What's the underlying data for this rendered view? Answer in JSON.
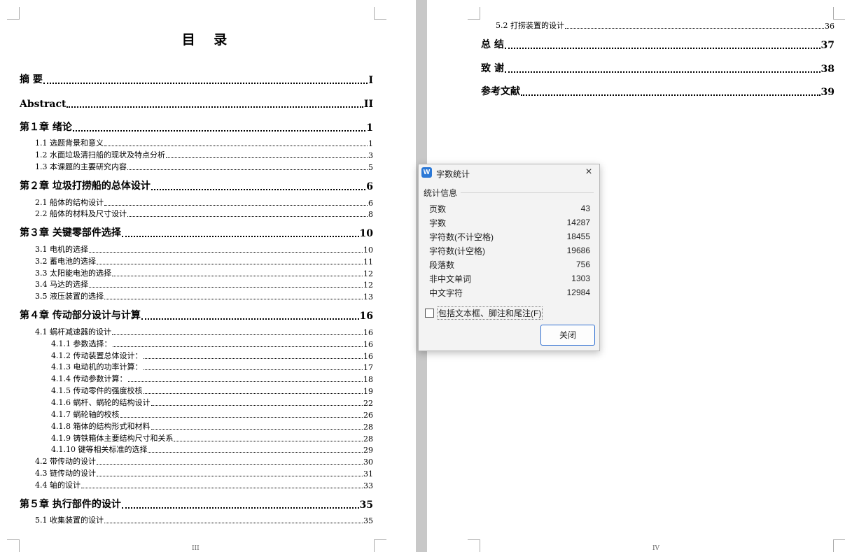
{
  "left_page": {
    "title": "目 录",
    "entries": [
      {
        "text": "摘  要",
        "page": "I"
      },
      {
        "text": "Abstract",
        "page": "II"
      },
      {
        "text": "第１章  绪论",
        "page": "1"
      },
      {
        "text": "1.1 选题背景和意义",
        "page": "1"
      },
      {
        "text": "1.2 水面垃圾清扫船的现状及特点分析",
        "page": "3"
      },
      {
        "text": "1.3 本课题的主要研究内容",
        "page": "5"
      },
      {
        "text": "第２章  垃圾打捞船的总体设计",
        "page": "6"
      },
      {
        "text": "2.1 船体的结构设计",
        "page": "6"
      },
      {
        "text": "2.2 船体的材料及尺寸设计",
        "page": "8"
      },
      {
        "text": "第３章 关键零部件选择",
        "page": "10"
      },
      {
        "text": "3.1 电机的选择",
        "page": "10"
      },
      {
        "text": "3.2 蓄电池的选择",
        "page": "11"
      },
      {
        "text": "3.3 太阳能电池的选择",
        "page": "12"
      },
      {
        "text": "3.4 马达的选择",
        "page": "12"
      },
      {
        "text": "3.5 液压装置的选择",
        "page": "13"
      },
      {
        "text": "第４章  传动部分设计与计算",
        "page": "16"
      },
      {
        "text": "4.1 蜗杆减速器的设计",
        "page": "16"
      },
      {
        "text": "4.1.1 参数选择：",
        "page": "16"
      },
      {
        "text": "4.1.2 传动装置总体设计：",
        "page": "16"
      },
      {
        "text": "4.1.3  电动机的功率计算：",
        "page": "17"
      },
      {
        "text": "4.1.4 传动参数计算：",
        "page": "18"
      },
      {
        "text": "4.1.5 传动零件的强度校核",
        "page": "19"
      },
      {
        "text": "4.1.6 蜗杆、蜗轮的结构设计",
        "page": "22"
      },
      {
        "text": "4.1.7 蜗轮轴的校核",
        "page": "26"
      },
      {
        "text": "4.1.8 箱体的结构形式和材料",
        "page": "28"
      },
      {
        "text": "4.1.9 铸铁箱体主要结构尺寸和关系",
        "page": "28"
      },
      {
        "text": "4.1.10 键等相关标准的选择",
        "page": "29"
      },
      {
        "text": "4.2 带传动的设计",
        "page": "30"
      },
      {
        "text": "4.3 链传动的设计",
        "page": "31"
      },
      {
        "text": "4.4 轴的设计",
        "page": "33"
      },
      {
        "text": "第５章  执行部件的设计",
        "page": "35"
      },
      {
        "text": "5.1 收集装置的设计",
        "page": "35"
      }
    ],
    "footer": "III"
  },
  "right_page": {
    "entries": [
      {
        "text": "5.2 打捞装置的设计",
        "page": "36"
      },
      {
        "text": "总  结",
        "page": "37"
      },
      {
        "text": "致  谢",
        "page": "38"
      },
      {
        "text": "参考文献",
        "page": "39"
      }
    ],
    "footer": "IV"
  },
  "dialog": {
    "logo": "W",
    "title": "字数统计",
    "group_label": "统计信息",
    "stats": [
      {
        "label": "页数",
        "value": "43"
      },
      {
        "label": "字数",
        "value": "14287"
      },
      {
        "label": "字符数(不计空格)",
        "value": "18455"
      },
      {
        "label": "字符数(计空格)",
        "value": "19686"
      },
      {
        "label": "段落数",
        "value": "756"
      },
      {
        "label": "非中文单词",
        "value": "1303"
      },
      {
        "label": "中文字符",
        "value": "12984"
      }
    ],
    "checkbox_label": "包括文本框、脚注和尾注(F)",
    "close_button": "关闭",
    "close_icon": "×"
  }
}
